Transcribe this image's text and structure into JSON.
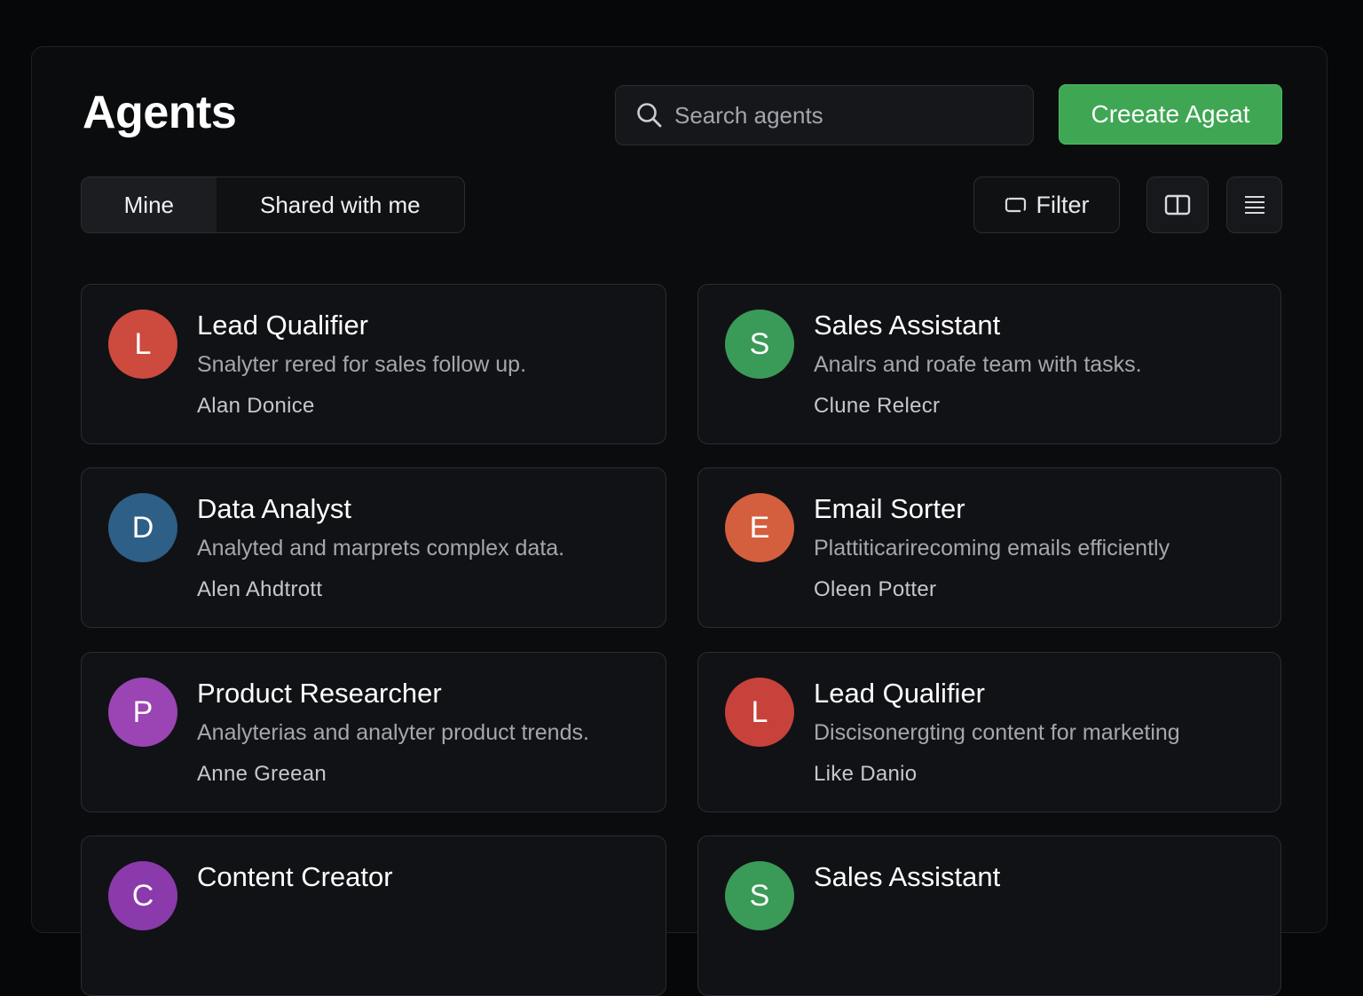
{
  "header": {
    "title": "Agents",
    "search_placeholder": "Search agents",
    "create_button": "Creeate Ageat"
  },
  "tabs": [
    {
      "label": "Mine",
      "active": true
    },
    {
      "label": "Shared with me",
      "active": false
    }
  ],
  "toolbar": {
    "filter_label": "Filter",
    "filter_icon": "filter-icon",
    "split_view_icon": "split-view-icon",
    "list_view_icon": "list-view-icon"
  },
  "agents": [
    {
      "initial": "L",
      "name": "Lead Qualifier",
      "description": "Snalyter rered for sales follow up.",
      "owner": "Alan Donice",
      "color": "#cc4a3e"
    },
    {
      "initial": "S",
      "name": "Sales Assistant",
      "description": "Analrs and roafe team with tasks.",
      "owner": "Clune Relecr",
      "color": "#3a9a57"
    },
    {
      "initial": "D",
      "name": "Data Analyst",
      "description": "Analyted and marprets complex data.",
      "owner": "Alen Ahdtrott",
      "color": "#2e5f86"
    },
    {
      "initial": "E",
      "name": "Email Sorter",
      "description": "Plattiticarirecoming emails efficiently",
      "owner": "Oleen Potter",
      "color": "#d45f3e"
    },
    {
      "initial": "P",
      "name": "Product Researcher",
      "description": "Analyterias and analyter product trends.",
      "owner": "Anne Greean",
      "color": "#9b44b3"
    },
    {
      "initial": "L",
      "name": "Lead Qualifier",
      "description": "Discisonergting content for marketing",
      "owner": "Like Danio",
      "color": "#c8423c"
    },
    {
      "initial": "C",
      "name": "Content Creator",
      "description": "",
      "owner": "",
      "color": "#8a3aaa"
    },
    {
      "initial": "S",
      "name": "Sales Assistant",
      "description": "",
      "owner": "",
      "color": "#3a9a57"
    }
  ],
  "colors": {
    "accent_green": "#3fa654",
    "background": "#060709",
    "panel": "#0b0c0e",
    "card": "#111215"
  }
}
